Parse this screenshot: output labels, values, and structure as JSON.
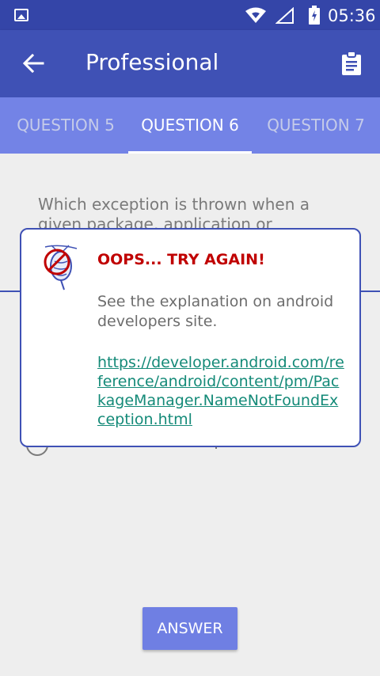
{
  "status_bar": {
    "time": "05:36",
    "icons": [
      "image-notification-icon",
      "wifi-icon",
      "signal-icon",
      "battery-charging-icon"
    ]
  },
  "app_bar": {
    "title": "Professional",
    "back_icon": "arrow-back-icon",
    "action_icon": "clipboard-icon",
    "background": "#3f51b5"
  },
  "tabs": [
    {
      "label": "QUESTION 5",
      "active": false
    },
    {
      "label": "QUESTION 6",
      "active": true
    },
    {
      "label": "QUESTION 7",
      "active": false
    }
  ],
  "question": {
    "text": "Which exception is thrown when a given package, application or component name"
  },
  "dialog": {
    "icon": "bug-crossed-icon",
    "title": "OOPS... TRY AGAIN!",
    "message": "See the explanation on android developers site.",
    "link": "https://developer.android.com/reference/android/content/pm/PackageManager.NameNotFoundException.html"
  },
  "answer_button": {
    "label": "ANSWER"
  },
  "colors": {
    "primary": "#3f51b5",
    "tab_bar": "#7383e6",
    "button": "#6f7fe3",
    "error": "#c00000",
    "link": "#148a78"
  }
}
